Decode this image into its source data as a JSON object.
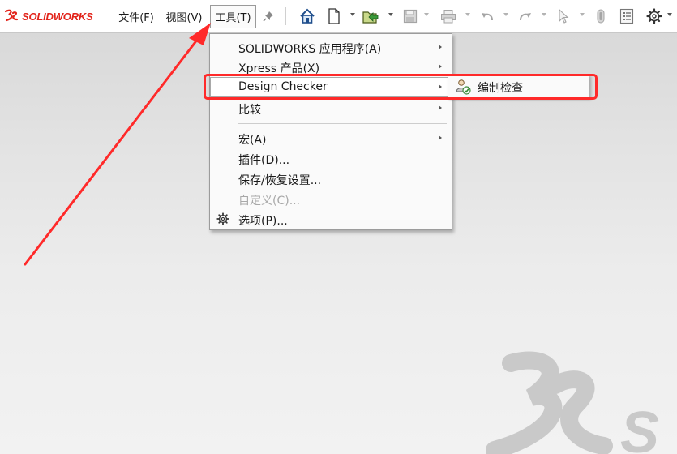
{
  "app": {
    "brand": "SOLIDWORKS",
    "accent_color": "#e2231a"
  },
  "menubar": {
    "items": [
      {
        "id": "file",
        "label": "文件(F)"
      },
      {
        "id": "view",
        "label": "视图(V)"
      },
      {
        "id": "tools",
        "label": "工具(T)",
        "active": true
      }
    ],
    "pin_icon": "pin-icon"
  },
  "toolbar": {
    "icons": [
      "home-icon",
      "new-document-icon",
      "open-icon",
      "save-icon",
      "print-icon",
      "undo-icon",
      "redo-icon",
      "select-pointer-icon",
      "rebuild-icon",
      "file-properties-icon",
      "options-gear-icon"
    ]
  },
  "tools_menu": {
    "items": [
      {
        "label": "SOLIDWORKS 应用程序(A)",
        "submenu": true
      },
      {
        "label": "Xpress 产品(X)",
        "submenu": true
      },
      {
        "label": "Design Checker",
        "submenu": true,
        "highlighted": true
      },
      {
        "label": "比较",
        "submenu": true
      },
      {
        "label": "宏(A)",
        "submenu": true
      },
      {
        "label": "插件(D)...",
        "submenu": false
      },
      {
        "label": "保存/恢复设置...",
        "submenu": false
      },
      {
        "label": "自定义(C)...",
        "submenu": false,
        "disabled": true
      },
      {
        "label": "选项(P)...",
        "submenu": false,
        "icon": "options-gear-icon"
      }
    ]
  },
  "design_checker_submenu": {
    "items": [
      {
        "label": "编制检查",
        "icon": "edit-check-icon"
      }
    ]
  },
  "annotation": {
    "color": "#ff2a2a"
  }
}
